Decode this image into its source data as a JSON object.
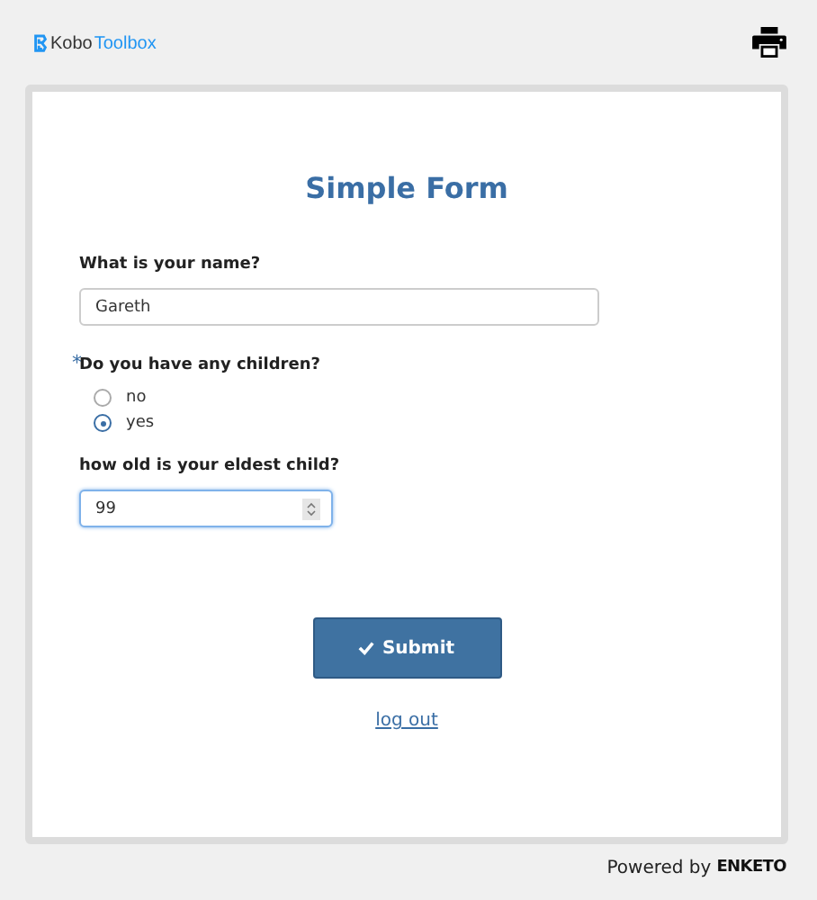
{
  "header": {
    "logo": {
      "part_1": "Kobo",
      "part_2": "Toolbox"
    }
  },
  "form": {
    "title": "Simple Form",
    "questions": [
      {
        "kind": "text",
        "label": "What is your name?",
        "value": "Gareth",
        "focused": false
      },
      {
        "kind": "radio",
        "label": "Do you have any children?",
        "required_mark": "*",
        "options": [
          {
            "label": "no",
            "selected": false
          },
          {
            "label": "yes",
            "selected": true
          }
        ]
      },
      {
        "kind": "number",
        "label": "how old is your eldest child?",
        "value": "99",
        "focused": true
      }
    ],
    "submit_label": "Submit",
    "logout_link": "log out"
  },
  "footer": {
    "powered_by": "Powered by",
    "brand": "ENKETO"
  }
}
